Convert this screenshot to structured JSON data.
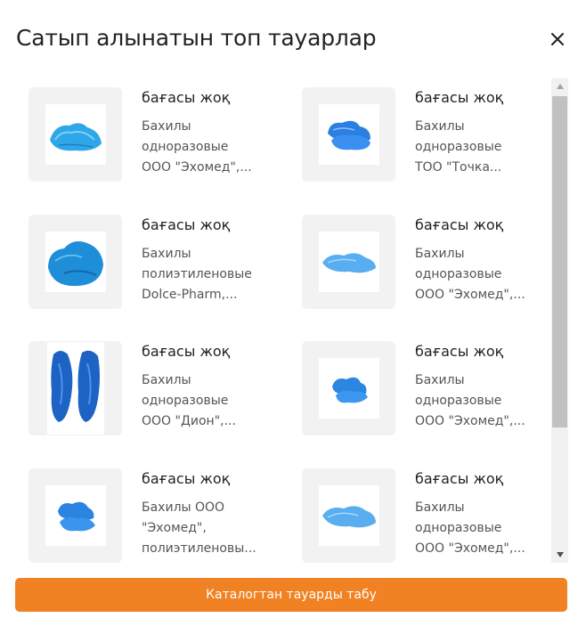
{
  "modal": {
    "title": "Сатып алынатын топ тауарлар",
    "close_icon": "close-icon"
  },
  "products": [
    {
      "price": "бағасы жоқ",
      "name_lines": [
        "Бахилы",
        "одноразовые",
        "ООО \"Эхомед\",..."
      ],
      "image": "blue-shoe-covers"
    },
    {
      "price": "бағасы жоқ",
      "name_lines": [
        "Бахилы",
        "одноразовые",
        "ТОО \"Точка..."
      ],
      "image": "blue-shoe-covers"
    },
    {
      "price": "бағасы жоқ",
      "name_lines": [
        "Бахилы",
        "полиэтиленовые",
        "Dolce-Pharm,..."
      ],
      "image": "blue-shoe-covers"
    },
    {
      "price": "бағасы жоқ",
      "name_lines": [
        "Бахилы",
        "одноразовые",
        "ООО \"Эхомед\",..."
      ],
      "image": "blue-shoe-covers"
    },
    {
      "price": "бағасы жоқ",
      "name_lines": [
        "Бахилы",
        "одноразовые",
        "ООО \"Дион\",..."
      ],
      "image": "blue-shoe-covers"
    },
    {
      "price": "бағасы жоқ",
      "name_lines": [
        "Бахилы",
        "одноразовые",
        "ООО \"Эхомед\",..."
      ],
      "image": "blue-shoe-covers"
    },
    {
      "price": "бағасы жоқ",
      "name_lines": [
        "Бахилы ООО",
        "\"Эхомед\",",
        "полиэтиленовы..."
      ],
      "image": "blue-shoe-covers"
    },
    {
      "price": "бағасы жоқ",
      "name_lines": [
        "Бахилы",
        "одноразовые",
        "ООО \"Эхомед\",..."
      ],
      "image": "blue-shoe-covers"
    }
  ],
  "footer": {
    "cta_label": "Каталогтан тауарды табу"
  },
  "colors": {
    "accent": "#f08223",
    "thumb_bg": "#f2f2f2",
    "product_blue": "#2b8fe0"
  }
}
